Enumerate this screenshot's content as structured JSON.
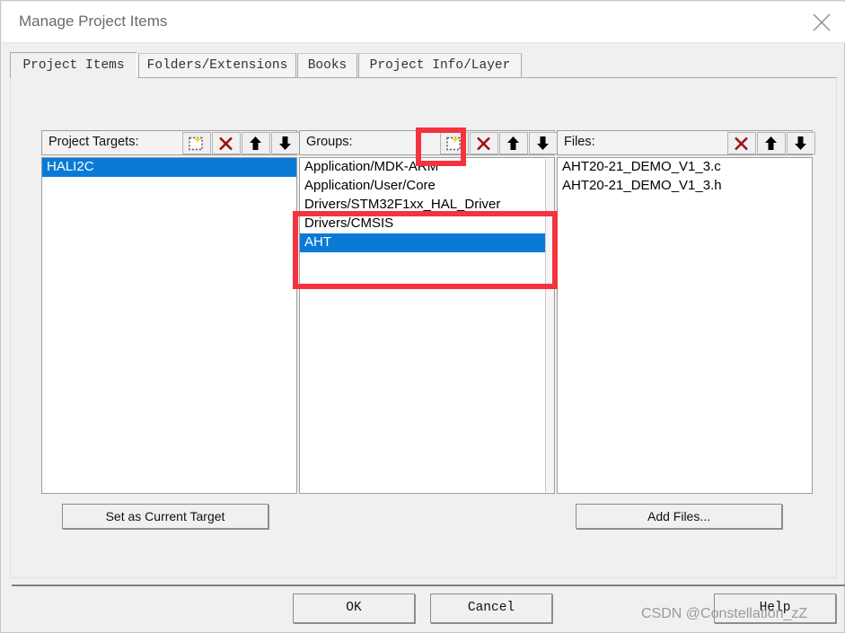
{
  "window": {
    "title": "Manage Project Items",
    "close_icon": "close-icon"
  },
  "tabs": [
    {
      "label": "Project Items",
      "active": true
    },
    {
      "label": "Folders/Extensions",
      "active": false
    },
    {
      "label": "Books",
      "active": false
    },
    {
      "label": "Project Info/Layer",
      "active": false
    }
  ],
  "columns": {
    "targets": {
      "header": "Project Targets:",
      "toolbar": [
        {
          "name": "new-item-icon",
          "title": "New (Insert)"
        },
        {
          "name": "delete-item-icon",
          "title": "Remove Item"
        },
        {
          "name": "move-up-icon",
          "title": "Move Up"
        },
        {
          "name": "move-down-icon",
          "title": "Move Down"
        }
      ],
      "items": [
        {
          "label": "HALI2C",
          "selected": true
        }
      ],
      "button": "Set as Current Target"
    },
    "groups": {
      "header": "Groups:",
      "toolbar": [
        {
          "name": "new-item-icon",
          "title": "New (Insert)"
        },
        {
          "name": "delete-item-icon",
          "title": "Remove Item"
        },
        {
          "name": "move-up-icon",
          "title": "Move Up"
        },
        {
          "name": "move-down-icon",
          "title": "Move Down"
        }
      ],
      "items": [
        {
          "label": "Application/MDK-ARM",
          "selected": false
        },
        {
          "label": "Application/User/Core",
          "selected": false
        },
        {
          "label": "Drivers/STM32F1xx_HAL_Driver",
          "selected": false
        },
        {
          "label": "Drivers/CMSIS",
          "selected": false
        },
        {
          "label": "AHT",
          "selected": true
        }
      ]
    },
    "files": {
      "header": "Files:",
      "toolbar": [
        {
          "name": "delete-item-icon",
          "title": "Remove Item"
        },
        {
          "name": "move-up-icon",
          "title": "Move Up"
        },
        {
          "name": "move-down-icon",
          "title": "Move Down"
        }
      ],
      "items": [
        {
          "label": "AHT20-21_DEMO_V1_3.c",
          "selected": false
        },
        {
          "label": "AHT20-21_DEMO_V1_3.h",
          "selected": false
        }
      ],
      "button": "Add Files..."
    }
  },
  "footer": {
    "ok": "OK",
    "cancel": "Cancel",
    "help": "Help"
  },
  "watermark": "CSDN @Constellation_zZ",
  "annotations": [
    {
      "name": "highlight-new-group-button"
    },
    {
      "name": "highlight-new-group-row"
    }
  ],
  "colors": {
    "selection_blue": "#0b7ad6",
    "annotation_red": "#f5333f",
    "dialog_bg": "#f0f0f0",
    "delete_icon_red": "#a01010"
  }
}
